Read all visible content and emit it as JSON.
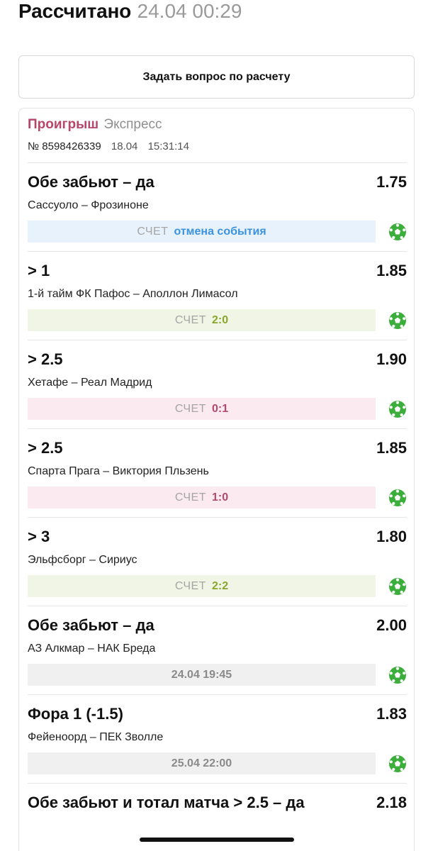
{
  "header": {
    "title": "Рассчитано",
    "timestamp": "24.04 00:29"
  },
  "ask_button": {
    "label": "Задать вопрос по расчету"
  },
  "bet_slip": {
    "status": "Проигрыш",
    "type": "Экспресс",
    "number": "№ 8598426339",
    "date": "18.04",
    "time": "15:31:14",
    "score_label": "СЧЕТ",
    "sport_icon": "soccer-ball-icon",
    "colors": {
      "lost": "#b8466a",
      "cancelled": "#3b93e0",
      "won": "#8aa62d",
      "lost_leg": "#b24a6c",
      "pending": "#8a8a8a",
      "sport_icon": "#3cae3c"
    },
    "bets": [
      {
        "pick": "Обе забьют – да",
        "odds": "1.75",
        "event": "Сассуоло – Фрозиноне",
        "result_kind": "score",
        "result": "отмена события",
        "result_state": "cancelled"
      },
      {
        "pick": "> 1",
        "odds": "1.85",
        "event": "1-й тайм ФК Пафос – Аполлон Лимасол",
        "result_kind": "score",
        "result": "2:0",
        "result_state": "won"
      },
      {
        "pick": "> 2.5",
        "odds": "1.90",
        "event": "Хетафе – Реал Мадрид",
        "result_kind": "score",
        "result": "0:1",
        "result_state": "lost"
      },
      {
        "pick": "> 2.5",
        "odds": "1.85",
        "event": "Спарта Прага – Виктория Пльзень",
        "result_kind": "score",
        "result": "1:0",
        "result_state": "lost"
      },
      {
        "pick": "> 3",
        "odds": "1.80",
        "event": "Эльфсборг – Сириус",
        "result_kind": "score",
        "result": "2:2",
        "result_state": "won"
      },
      {
        "pick": "Обе забьют – да",
        "odds": "2.00",
        "event": "АЗ Алкмар – НАК Бреда",
        "result_kind": "datetime",
        "result": "24.04 19:45",
        "result_state": "pending"
      },
      {
        "pick": "Фора 1 (-1.5)",
        "odds": "1.83",
        "event": "Фейеноорд – ПЕК Зволле",
        "result_kind": "datetime",
        "result": "25.04 22:00",
        "result_state": "pending"
      },
      {
        "pick": "Обе забьют и тотал матча > 2.5 – да",
        "odds": "2.18",
        "event": "",
        "result_kind": "none",
        "result": "",
        "result_state": "pending"
      }
    ]
  }
}
